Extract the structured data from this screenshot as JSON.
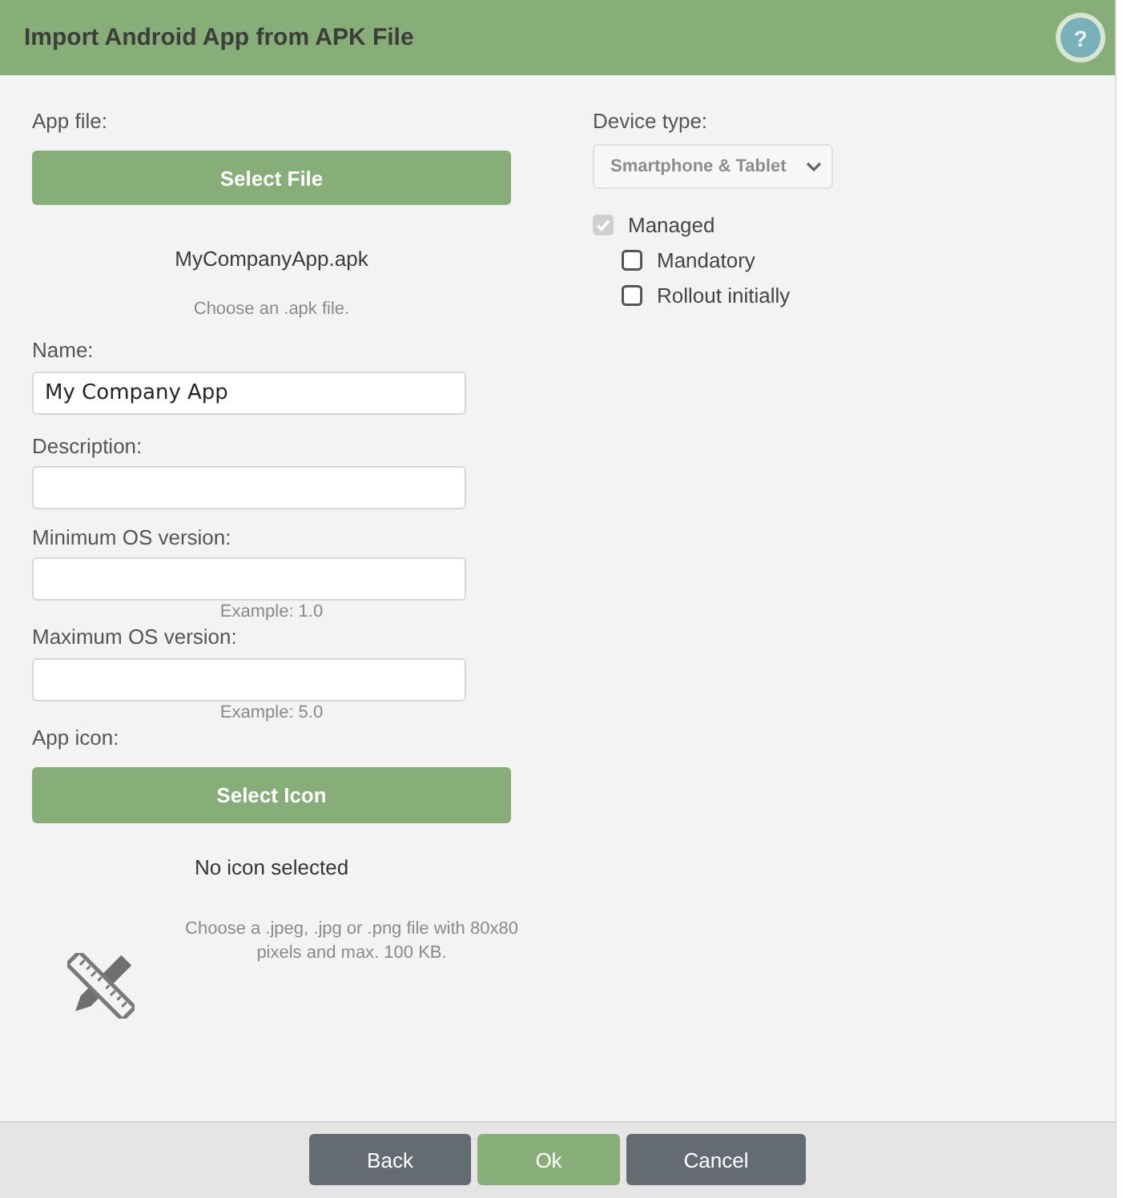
{
  "window": {
    "title": "Import Android App from APK File",
    "help": "?"
  },
  "app_file": {
    "label": "App file:",
    "button": "Select File",
    "file_name": "MyCompanyApp.apk",
    "hint": "Choose an .apk file."
  },
  "fields": [
    {
      "label": "Name:",
      "value": "My Company App"
    },
    {
      "label": "Description:"
    },
    {
      "label": "Minimum OS version:",
      "example": "Example: 1.0"
    },
    {
      "label": "Maximum OS version:",
      "example": "Example: 5.0"
    }
  ],
  "app_icon": {
    "label": "App icon:",
    "button": "Select Icon",
    "status": "No icon selected",
    "hint": "Choose a .jpeg, .jpg or .png file with 80x80 pixels and max. 100 KB."
  },
  "device_type": {
    "label": "Device type:",
    "value": "Smartphone & Tablet",
    "disabled": true
  },
  "options": [
    {
      "label": "Managed",
      "checked": true,
      "disabled": true,
      "children": [
        {
          "label": "Mandatory",
          "checked": false,
          "disabled": false
        },
        {
          "label": "Rollout initially",
          "checked": false,
          "disabled": false
        }
      ]
    }
  ],
  "buttons": [
    {
      "label": "Back",
      "kind": "secondary"
    },
    {
      "label": "Ok",
      "kind": "primary"
    },
    {
      "label": "Cancel",
      "kind": "secondary"
    }
  ]
}
